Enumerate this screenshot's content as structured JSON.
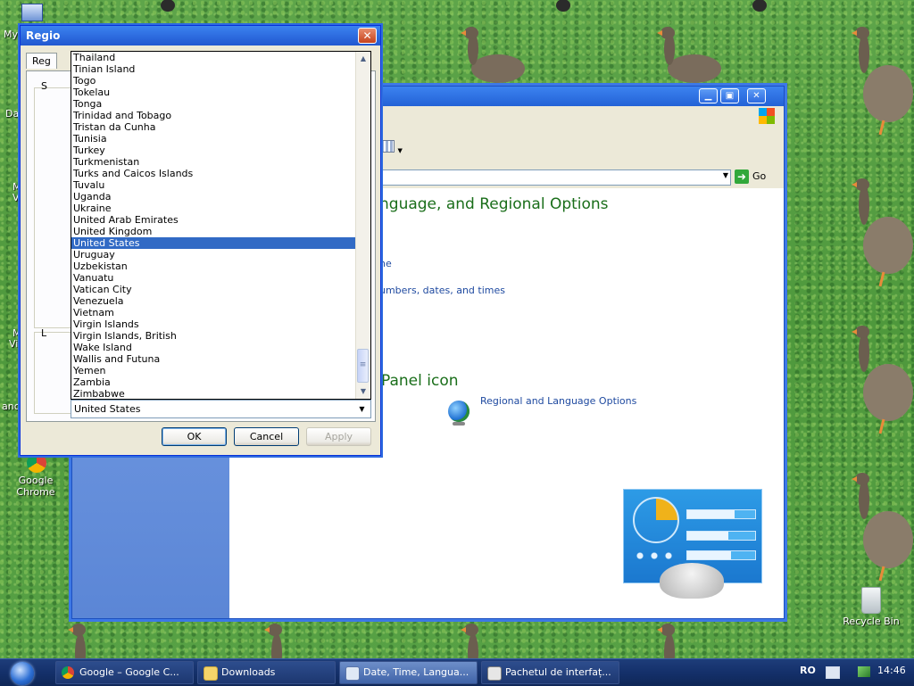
{
  "desktop": {
    "icons": [
      {
        "name": "my-computer",
        "label": "My"
      },
      {
        "name": "google-chrome",
        "label": "Google Chrome"
      },
      {
        "name": "recycle-bin",
        "label": "Recycle Bin"
      }
    ],
    "fragments": [
      "Da",
      "M",
      "V",
      "M",
      "Vi",
      "anc"
    ]
  },
  "control_panel": {
    "heading_main": "nguage, and Regional Options",
    "heading_icon": "Panel icon",
    "link_partial_1": "ne",
    "link_partial_2": "umbers, dates, and times",
    "icon_link": "Regional and Language Options",
    "go_label": "Go"
  },
  "dialog": {
    "title": "Regio",
    "tab_label": "Reg",
    "fragment_s": "S",
    "fragment_l": "L",
    "ok_label": "OK",
    "cancel_label": "Cancel",
    "apply_label": "Apply",
    "combo_value": "United States",
    "countries": [
      "Thailand",
      "Tinian Island",
      "Togo",
      "Tokelau",
      "Tonga",
      "Trinidad and Tobago",
      "Tristan da Cunha",
      "Tunisia",
      "Turkey",
      "Turkmenistan",
      "Turks and Caicos Islands",
      "Tuvalu",
      "Uganda",
      "Ukraine",
      "United Arab Emirates",
      "United Kingdom",
      "United States",
      "Uruguay",
      "Uzbekistan",
      "Vanuatu",
      "Vatican City",
      "Venezuela",
      "Vietnam",
      "Virgin Islands",
      "Virgin Islands, British",
      "Wake Island",
      "Wallis and Futuna",
      "Yemen",
      "Zambia",
      "Zimbabwe"
    ],
    "selected_country": "United States"
  },
  "taskbar": {
    "tasks": [
      {
        "label": "Google – Google C...",
        "icon": "chrome-icon",
        "active": false
      },
      {
        "label": "Downloads",
        "icon": "folder-icon",
        "active": false
      },
      {
        "label": "Date, Time, Langua...",
        "icon": "control-panel-icon",
        "active": true
      },
      {
        "label": "Pachetul de interfaț...",
        "icon": "installer-icon",
        "active": false
      }
    ],
    "language": "RO",
    "clock": "14:46"
  },
  "colors": {
    "selection": "#316ac5",
    "cp_heading": "#1a6e1a",
    "link": "#1f4aa0",
    "titlebar": "#2362d6"
  }
}
